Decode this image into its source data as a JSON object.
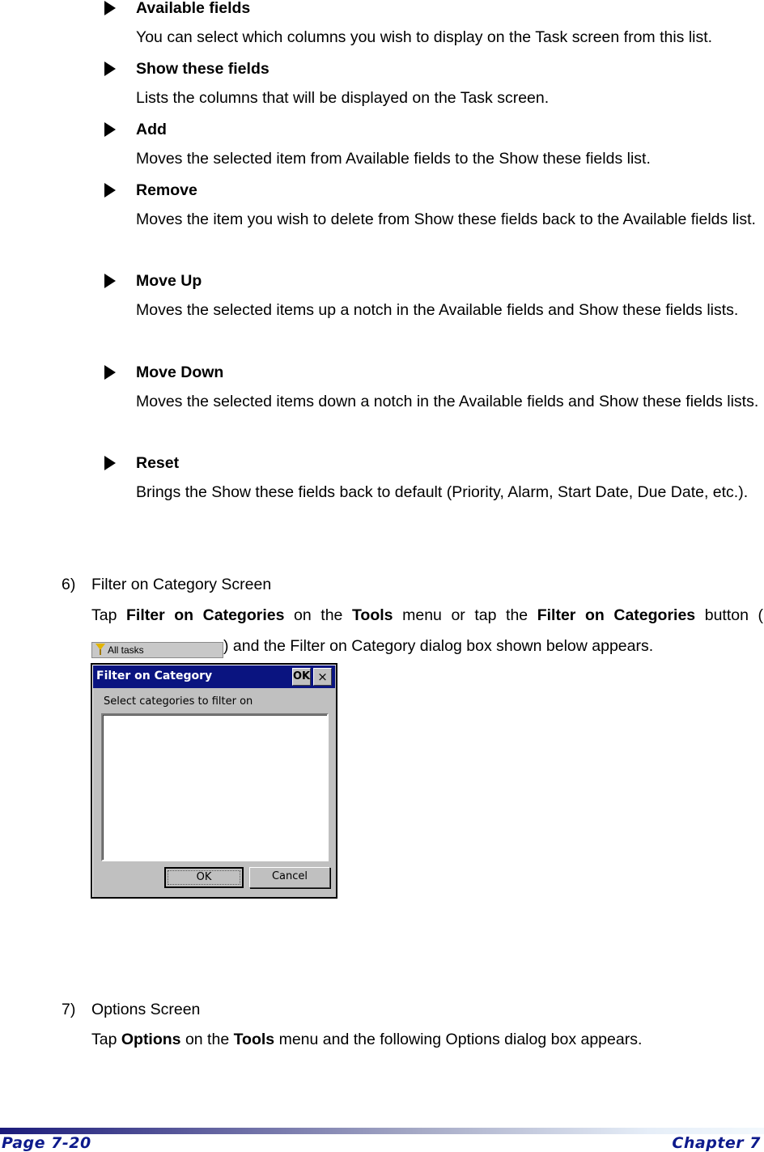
{
  "items": [
    {
      "heading": "Available fields",
      "lines": [
        "You can select which columns you wish to display on the Task screen from this list."
      ]
    },
    {
      "heading": "Show these fields",
      "lines": [
        "Lists the columns that will be displayed on the Task screen."
      ]
    },
    {
      "heading": "Add",
      "lines": [
        "Moves the selected item from Available fields to the Show these fields list."
      ]
    },
    {
      "heading": "Remove",
      "lines": [
        "Moves the item you wish to delete from Show these fields back to the Available fields list."
      ]
    },
    {
      "heading": "Move Up",
      "lines": [
        "Moves the selected items up a notch in the Available fields and Show these fields lists."
      ]
    },
    {
      "heading": "Move Down",
      "lines": [
        "Moves the selected items down a notch in the Available fields and Show these fields lists."
      ]
    },
    {
      "heading": "Reset",
      "lines": [
        "Brings the Show these fields back to default (Priority, Alarm, Start Date, Due Date, etc.)."
      ]
    }
  ],
  "section6": {
    "number": "6)",
    "title": "Filter on Category Screen",
    "p_tap": "Tap ",
    "p_bold1": "Filter on Categories",
    "p_on_the": " on the ",
    "p_bold2": "Tools",
    "p_menu_or": " menu or tap the ",
    "p_bold3": "Filter on Categories",
    "p_button": " button (",
    "p_after": ") and the Filter on Category dialog box shown below appears.",
    "inline_button_label": "All tasks"
  },
  "dialog": {
    "title": "Filter on Category",
    "title_ok": "OK",
    "title_close": "×",
    "prompt": "Select categories to filter on",
    "ok_label": "OK",
    "cancel_label": "Cancel"
  },
  "section7": {
    "number": "7)",
    "title": "Options Screen",
    "p_tap": "Tap ",
    "p_bold1": "Options",
    "p_on_the": " on the ",
    "p_bold2": "Tools",
    "p_after": " menu and the following Options dialog box appears."
  },
  "footer": {
    "page": "Page 7-20",
    "chapter": "Chapter 7",
    "accent_color": "#0d1a8c"
  }
}
